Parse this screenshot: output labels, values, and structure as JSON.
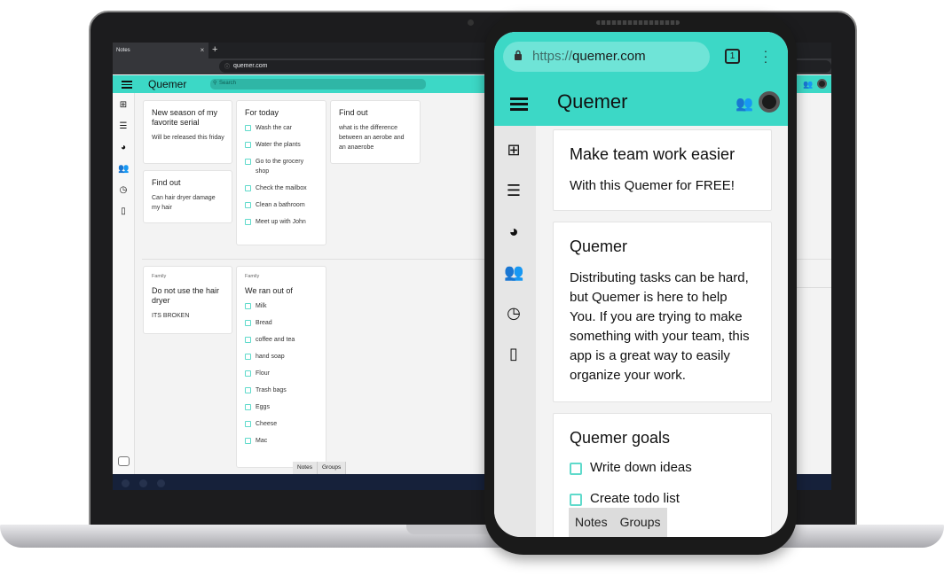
{
  "laptop": {
    "browser": {
      "tab_title": "Notes",
      "close_glyph": "×",
      "new_tab_glyph": "+",
      "url": "quemer.com"
    },
    "app": {
      "title": "Quemer",
      "search_placeholder": "Search"
    },
    "notes": [
      {
        "title": "New season of my favorite serial",
        "body": "Will be released this friday"
      },
      {
        "title": "Find out",
        "body": "Can hair dryer damage my hair"
      },
      {
        "title": "For today",
        "items": [
          "Wash the car",
          "Water the plants",
          "Go to the grocery shop",
          "Check the mailbox",
          "Clean a bathroom",
          "Meet up with John"
        ]
      },
      {
        "title": "Find out",
        "body": "what is the difference between an aerobe and an anaerobe"
      }
    ],
    "family_notes": [
      {
        "label": "Family",
        "title": "Do not use the hair dryer",
        "body": "ITS BROKEN"
      },
      {
        "label": "Family",
        "title": "We ran out of",
        "items": [
          "Milk",
          "Bread",
          "coffee and tea",
          "hand soap",
          "Flour",
          "Trash bags",
          "Eggs",
          "Cheese",
          "Mac"
        ]
      }
    ],
    "bottom_tabs": [
      "Notes",
      "Groups"
    ]
  },
  "phone": {
    "browser": {
      "url_scheme": "https://",
      "url_host": "quemer.com",
      "tab_count": "1"
    },
    "app": {
      "title": "Quemer"
    },
    "cards": [
      {
        "title": "Make team work easier",
        "body": "With this Quemer for FREE!"
      },
      {
        "title": "Quemer",
        "body": "Distributing tasks can be hard, but Quemer is here to help You. If you are trying to make something with your team, this app is a great way to easily organize your work."
      },
      {
        "title": "Quemer goals",
        "items": [
          "Write down ideas",
          "Create todo list"
        ]
      }
    ],
    "bottom_tabs": [
      "Notes",
      "Groups"
    ]
  },
  "colors": {
    "accent": "#3cd8c6",
    "accent_light": "#6fe4d7",
    "checkbox": "#5fdacb"
  },
  "icons": [
    "add-note-icon",
    "checklist-icon",
    "pie-chart-icon",
    "group-icon",
    "clock-icon",
    "phone-icon",
    "lock-icon",
    "more-vert-icon"
  ]
}
